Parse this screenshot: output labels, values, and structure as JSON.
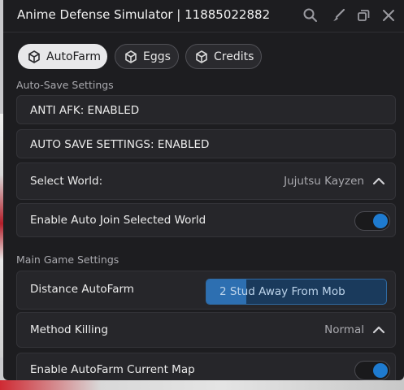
{
  "window": {
    "title": "Anime Defense Simulator | 11885022882",
    "icons": [
      "search-icon",
      "brush-icon",
      "restore-icon",
      "close-icon"
    ]
  },
  "tabs": [
    {
      "label": "AutoFarm",
      "active": true,
      "icon": "box-icon"
    },
    {
      "label": "Eggs",
      "active": false,
      "icon": "box-icon"
    },
    {
      "label": "Credits",
      "active": false,
      "icon": "box-icon"
    }
  ],
  "sections": {
    "auto_save": "Auto-Save Settings",
    "main_game": "Main Game Settings"
  },
  "rows": {
    "anti_afk": "ANTI AFK: ENABLED",
    "auto_save": "AUTO SAVE SETTINGS: ENABLED",
    "select_world": {
      "label": "Select World:",
      "value": "Jujutsu Kayzen"
    },
    "auto_join": {
      "label": "Enable Auto Join Selected World",
      "on": true
    },
    "distance": {
      "label": "Distance AutoFarm",
      "value": "2 Stud Away From Mob",
      "fill": 0.22
    },
    "method": {
      "label": "Method Killing",
      "value": "Normal"
    },
    "autofarm_map": {
      "label": "Enable AutoFarm Current Map",
      "on": true
    }
  },
  "colors": {
    "accent": "#1e7bd0",
    "window_bg": "#1d1d20",
    "row_bg": "#26262a"
  }
}
